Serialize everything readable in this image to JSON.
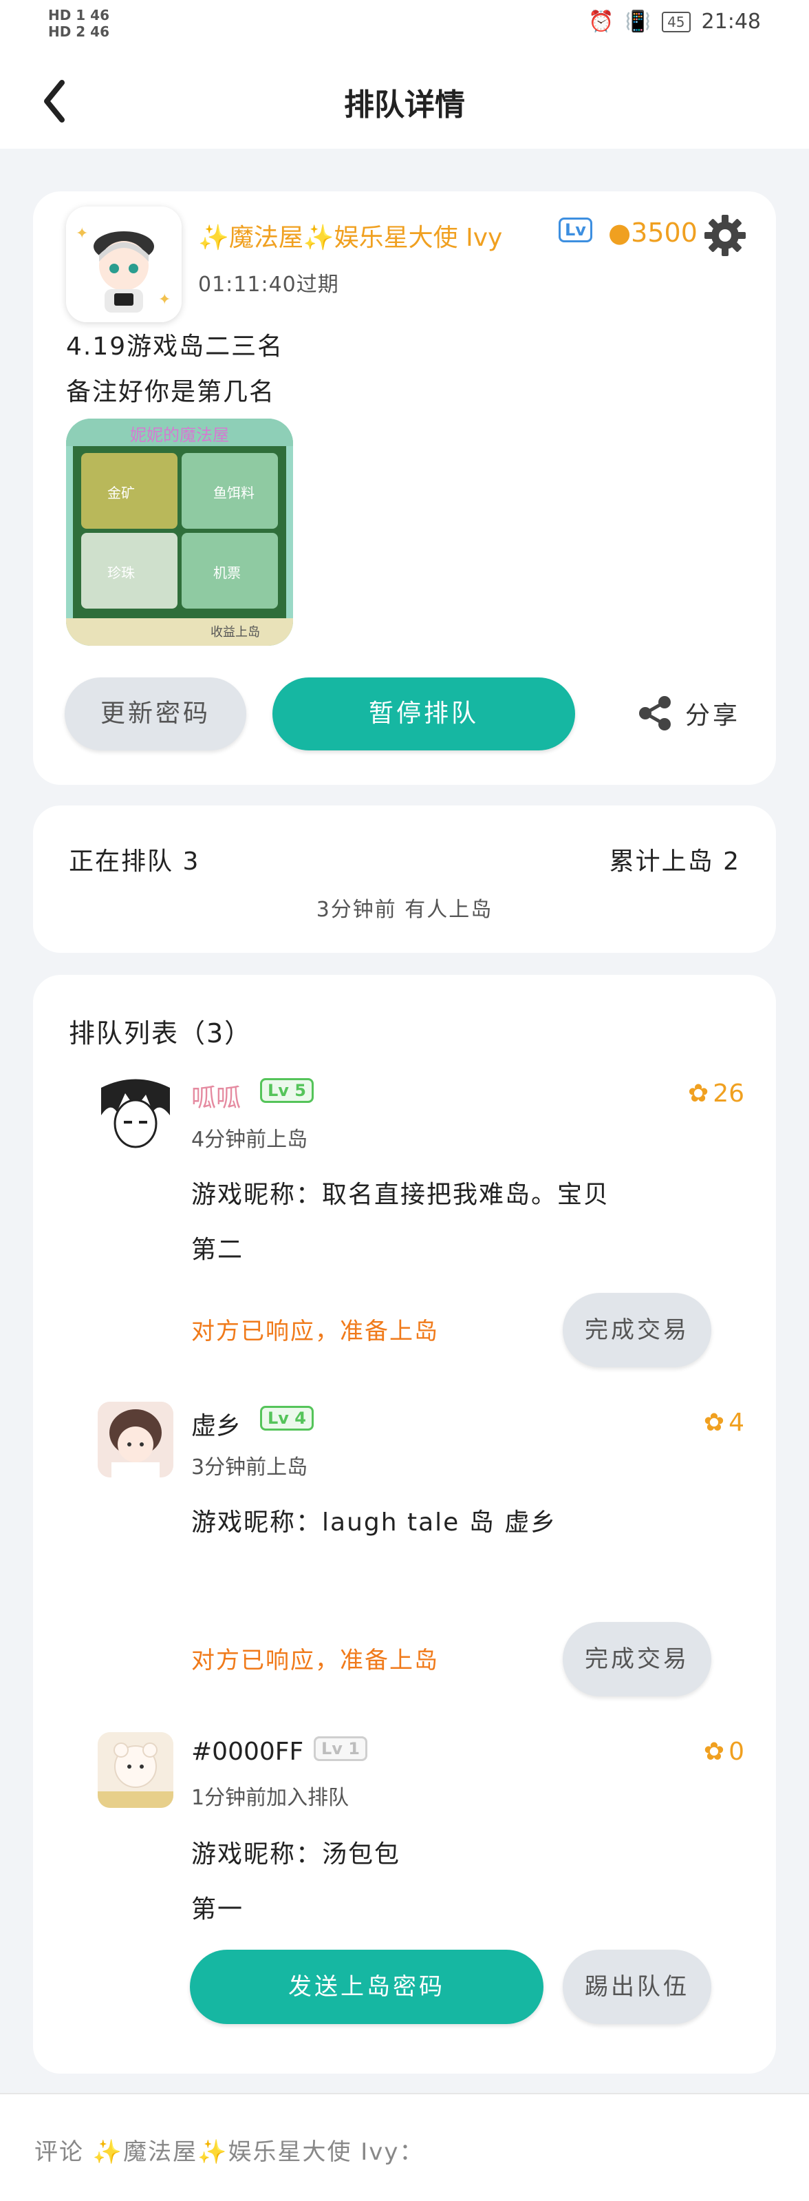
{
  "status_bar": {
    "left_top": "HD 1 46",
    "left_bottom": "HD 2 46",
    "battery": "45",
    "time": "21:48"
  },
  "header": {
    "title": "排队详情"
  },
  "host": {
    "name": "✨魔法屋✨娱乐星大使 Ivy",
    "level": "Lv",
    "score": "3500",
    "expire": "01:11:40过期",
    "note_line1": "4.19游戏岛二三名",
    "note_line2": "备注好你是第几名",
    "map_title": "妮妮的魔法屋",
    "map_cells": [
      "金矿",
      "鱼饵料",
      "珍珠",
      "机票"
    ],
    "map_footer": "收益上岛",
    "btn_update": "更新密码",
    "btn_pause": "暂停排队",
    "btn_share": "分享"
  },
  "stats": {
    "queueing": "正在排队 3",
    "total": "累计上岛 2",
    "recent": "3分钟前 有人上岛"
  },
  "queue": {
    "title": "排队列表（3）",
    "items": [
      {
        "name": "呱呱",
        "level": "Lv 5",
        "coins": "26",
        "time": "4分钟前上岛",
        "line1": "游戏昵称：取名直接把我难岛。宝贝",
        "line2": "第二",
        "status": "对方已响应，准备上岛",
        "action": "完成交易"
      },
      {
        "name": "虚乡",
        "level": "Lv 4",
        "coins": "4",
        "time": "3分钟前上岛",
        "line1": "游戏昵称：laugh tale 岛  虚乡",
        "line2": "",
        "status": "对方已响应，准备上岛",
        "action": "完成交易"
      },
      {
        "name": "#0000FF",
        "level": "Lv 1",
        "coins": "0",
        "time": "1分钟前加入排队",
        "line1": "游戏昵称：汤包包",
        "line2": "第一",
        "send": "发送上岛密码",
        "kick": "踢出队伍"
      }
    ]
  },
  "comment": {
    "label": "评论 ✨魔法屋✨娱乐星大使 Ivy："
  },
  "colors": {
    "teal": "#16b7a2",
    "orange": "#f0a020",
    "pink": "#e58aa0"
  }
}
